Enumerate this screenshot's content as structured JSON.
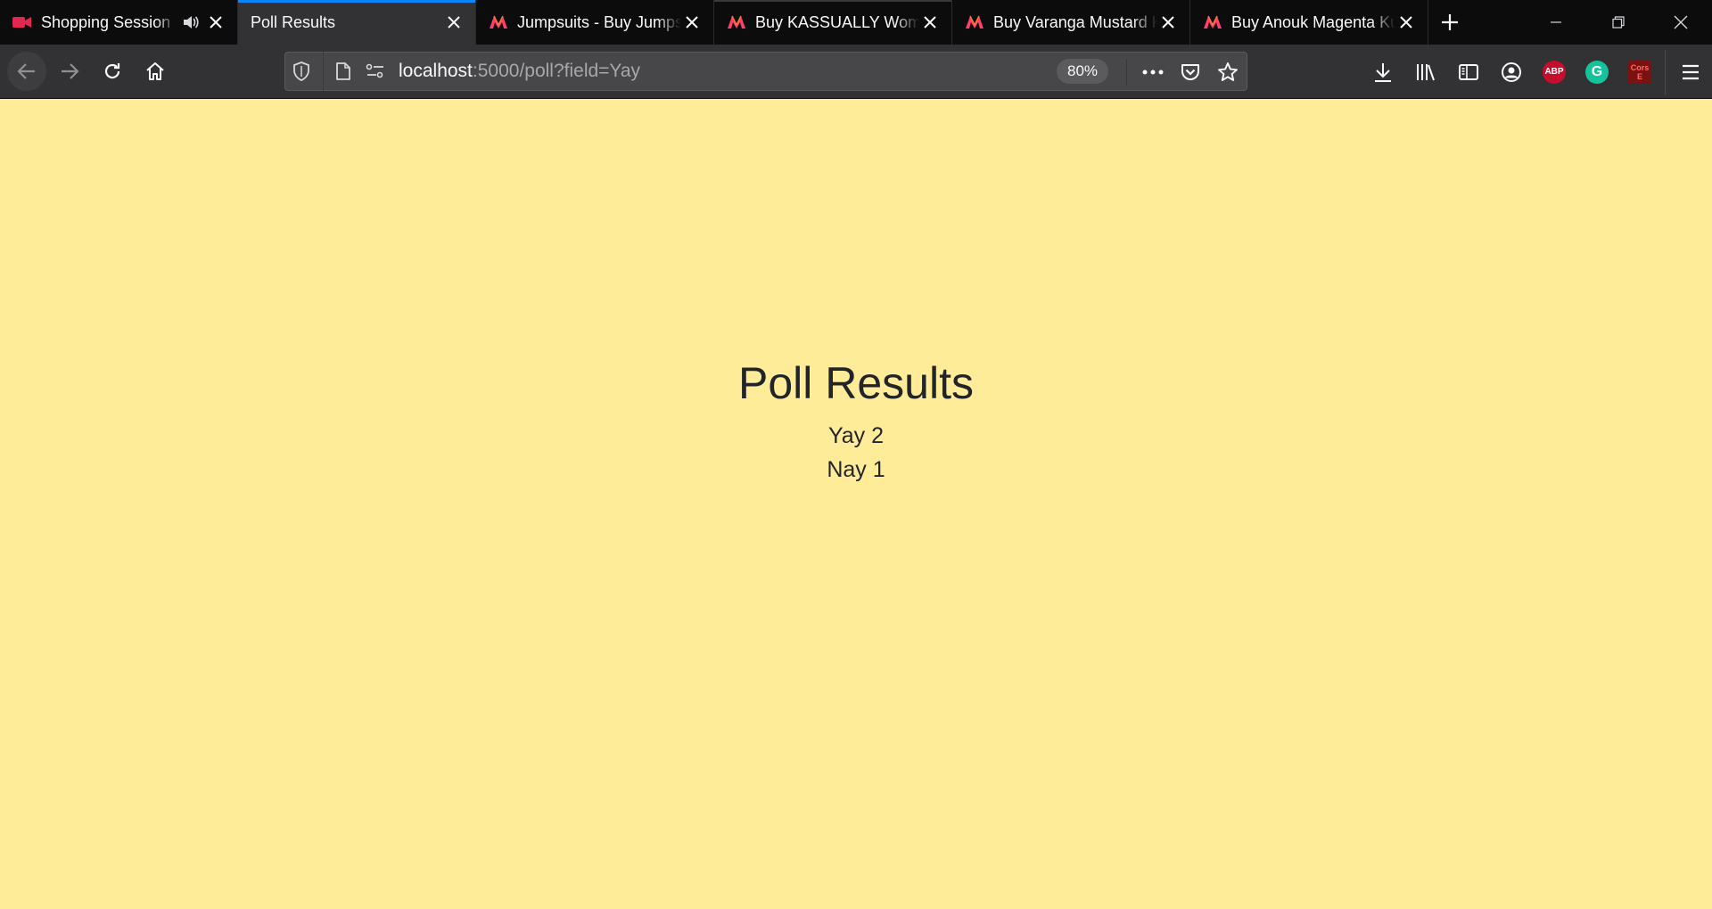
{
  "tabs": [
    {
      "title": "Shopping Session",
      "favicon": "video-camera-icon",
      "audio": true
    },
    {
      "title": "Poll Results",
      "favicon": "none"
    },
    {
      "title": "Jumpsuits - Buy Jumpsuits",
      "favicon": "myntra-logo"
    },
    {
      "title": "Buy KASSUALLY Women",
      "favicon": "myntra-logo"
    },
    {
      "title": "Buy Varanga Mustard Kurta",
      "favicon": "myntra-logo"
    },
    {
      "title": "Buy Anouk Magenta Kurta",
      "favicon": "myntra-logo"
    }
  ],
  "urlbar": {
    "host": "localhost",
    "rest": ":5000/poll?field=Yay",
    "zoom": "80%"
  },
  "extensions": {
    "abp_label": "ABP",
    "grammarly_label": "G",
    "cors_label_line1": "Cors",
    "cors_label_line2": "E"
  },
  "page": {
    "title": "Poll Results",
    "results": [
      {
        "label": "Yay",
        "count": "2",
        "text": "Yay 2"
      },
      {
        "label": "Nay",
        "count": "1",
        "text": "Nay 1"
      }
    ]
  },
  "colors": {
    "page_background": "#ffec99",
    "tab_accent": "#0a84ff",
    "chrome_dark": "#0c0c0d",
    "toolbar": "#323234"
  }
}
